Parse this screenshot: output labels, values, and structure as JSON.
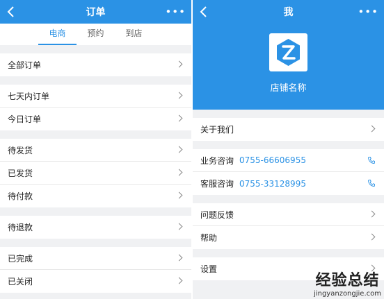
{
  "left": {
    "title": "订单",
    "tabs": [
      "电商",
      "预约",
      "到店"
    ],
    "groups": [
      [
        "全部订单"
      ],
      [
        "七天内订单",
        "今日订单"
      ],
      [
        "待发货",
        "已发货",
        "待付款"
      ],
      [
        "待退款"
      ],
      [
        "已完成",
        "已关闭"
      ]
    ]
  },
  "right": {
    "title": "我",
    "shop_name": "店铺名称",
    "about": "关于我们",
    "business_label": "业务咨询",
    "business_phone": "0755-66606955",
    "service_label": "客服咨询",
    "service_phone": "0755-33128995",
    "feedback": "问题反馈",
    "help": "帮助",
    "settings": "设置"
  },
  "watermark": {
    "cn": "经验总结",
    "en": "jingyanzongjie.com"
  },
  "colors": {
    "accent": "#2b92e5",
    "background": "#f0f1f3"
  }
}
